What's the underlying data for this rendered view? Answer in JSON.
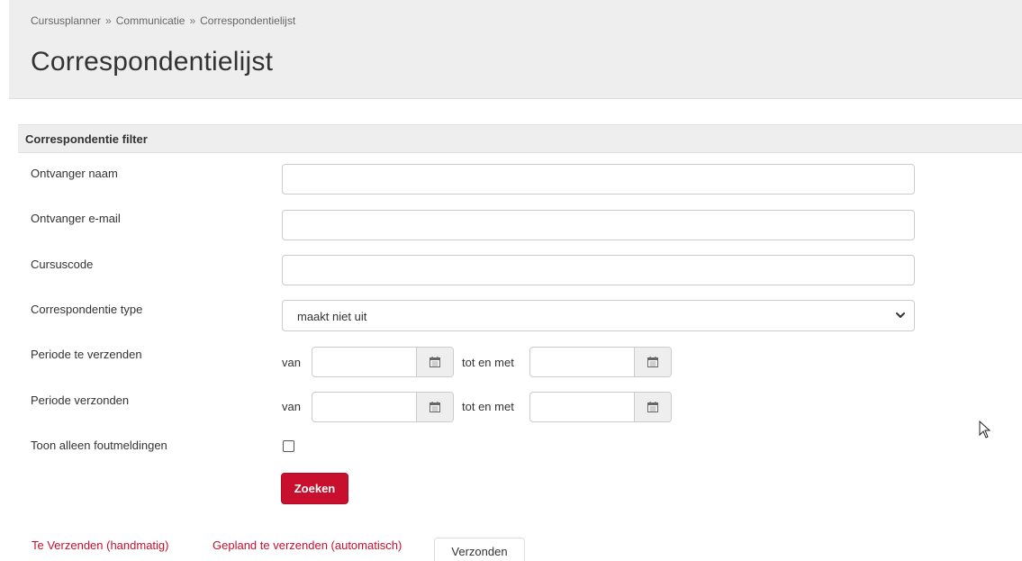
{
  "breadcrumb": {
    "items": [
      "Cursusplanner",
      "Communicatie",
      "Correspondentielijst"
    ],
    "separator": "»"
  },
  "page": {
    "title": "Correspondentielijst"
  },
  "filter": {
    "heading": "Correspondentie filter",
    "recipient_name": {
      "label": "Ontvanger naam",
      "value": ""
    },
    "recipient_email": {
      "label": "Ontvanger e-mail",
      "value": ""
    },
    "course_code": {
      "label": "Cursuscode",
      "value": ""
    },
    "correspondence_type": {
      "label": "Correspondentie type",
      "selected": "maakt niet uit"
    },
    "period_to_send": {
      "label": "Periode te verzenden",
      "from_label": "van",
      "to_label": "tot en met",
      "from_value": "",
      "to_value": ""
    },
    "period_sent": {
      "label": "Periode verzonden",
      "from_label": "van",
      "to_label": "tot en met",
      "from_value": "",
      "to_value": ""
    },
    "errors_only": {
      "label": "Toon alleen foutmeldingen",
      "checked": false
    },
    "search_button": "Zoeken"
  },
  "tabs": [
    {
      "label": "Te Verzenden (handmatig)",
      "active": false
    },
    {
      "label": "Gepland te verzenden (automatisch)",
      "active": false
    },
    {
      "label": "Verzonden",
      "active": true
    }
  ],
  "icons": {
    "calendar": "calendar-icon",
    "chevron": "chevron-down-icon",
    "cursor": "mouse-pointer-icon"
  },
  "colors": {
    "accent": "#c8102e",
    "header_bg": "#eeeeee"
  }
}
